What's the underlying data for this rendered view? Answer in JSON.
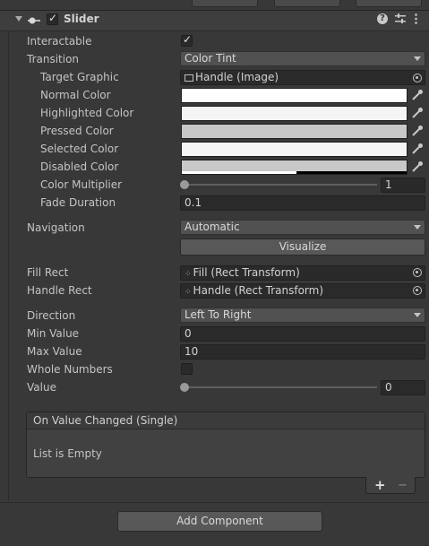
{
  "component": {
    "title": "Slider",
    "enabled": true
  },
  "fields": {
    "interactable_label": "Interactable",
    "interactable_checked": true,
    "transition_label": "Transition",
    "transition_value": "Color Tint",
    "target_graphic_label": "Target Graphic",
    "target_graphic_value": "Handle (Image)",
    "normal_color_label": "Normal Color",
    "highlighted_color_label": "Highlighted Color",
    "pressed_color_label": "Pressed Color",
    "selected_color_label": "Selected Color",
    "disabled_color_label": "Disabled Color",
    "color_multiplier_label": "Color Multiplier",
    "color_multiplier_value": "1",
    "fade_duration_label": "Fade Duration",
    "fade_duration_value": "0.1",
    "navigation_label": "Navigation",
    "navigation_value": "Automatic",
    "visualize_label": "Visualize",
    "fill_rect_label": "Fill Rect",
    "fill_rect_value": "Fill (Rect Transform)",
    "handle_rect_label": "Handle Rect",
    "handle_rect_value": "Handle (Rect Transform)",
    "direction_label": "Direction",
    "direction_value": "Left To Right",
    "min_value_label": "Min Value",
    "min_value_value": "0",
    "max_value_label": "Max Value",
    "max_value_value": "10",
    "whole_numbers_label": "Whole Numbers",
    "whole_numbers_checked": false,
    "value_label": "Value",
    "value_value": "0"
  },
  "colors": {
    "normal": "#ffffff",
    "highlighted": "#f5f5f5",
    "pressed": "#c8c8c8",
    "selected": "#f5f5f5",
    "disabled": "#c8c8c8"
  },
  "event": {
    "header": "On Value Changed (Single)",
    "empty_text": "List is Empty",
    "add_symbol": "+",
    "remove_symbol": "−"
  },
  "add_component_label": "Add Component",
  "icons": {
    "foldout": "triangle-down-icon",
    "component": "slider-component-icon",
    "help": "help-icon",
    "presets": "sliders-preset-icon",
    "menu": "kebab-menu-icon",
    "picker": "eyedropper-icon",
    "object_picker": "target-circle-icon",
    "image": "image-icon",
    "rect_transform": "rect-transform-icon"
  }
}
